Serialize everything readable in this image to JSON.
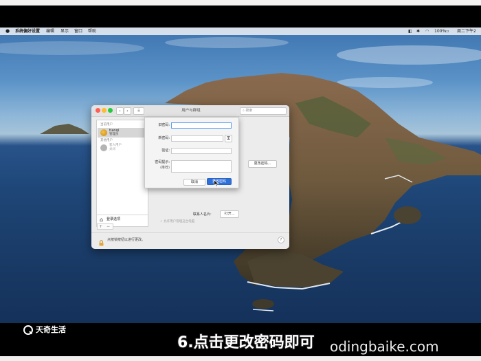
{
  "menubar": {
    "items": [
      "系统偏好设置",
      "编辑",
      "显示",
      "窗口",
      "帮助"
    ],
    "battery": "100%",
    "clock": "周二下午2"
  },
  "window": {
    "title": "用户与群组",
    "search_placeholder": "搜索",
    "sidebar": {
      "current_user_header": "当前用户",
      "current_user_name": "tianqi",
      "current_user_role": "管理员",
      "other_users_header": "其他用户",
      "guest_name": "客人用户",
      "guest_status": "关闭"
    },
    "login_options": "登录选项",
    "change_password_button": "更改密码...",
    "contact_card_label": "联系人名片:",
    "open_button": "打开...",
    "allow_admin": "允许用户管理这台电脑",
    "lock_text": "点按锁按钮以进行更改。",
    "help": "?"
  },
  "sheet": {
    "old_password_label": "旧密码:",
    "new_password_label": "新密码:",
    "verify_label": "验证:",
    "hint_label": "密码提示:",
    "hint_sub": "(推荐)",
    "cancel_button": "取消",
    "change_button": "更改密码"
  },
  "overlay": {
    "brand": "天奇生活",
    "subtitle": "6.点击更改密码即可",
    "watermark": "odingbaike.com"
  },
  "colors": {
    "accent": "#2f6fd8",
    "focus_ring": "#5b9cf0"
  }
}
